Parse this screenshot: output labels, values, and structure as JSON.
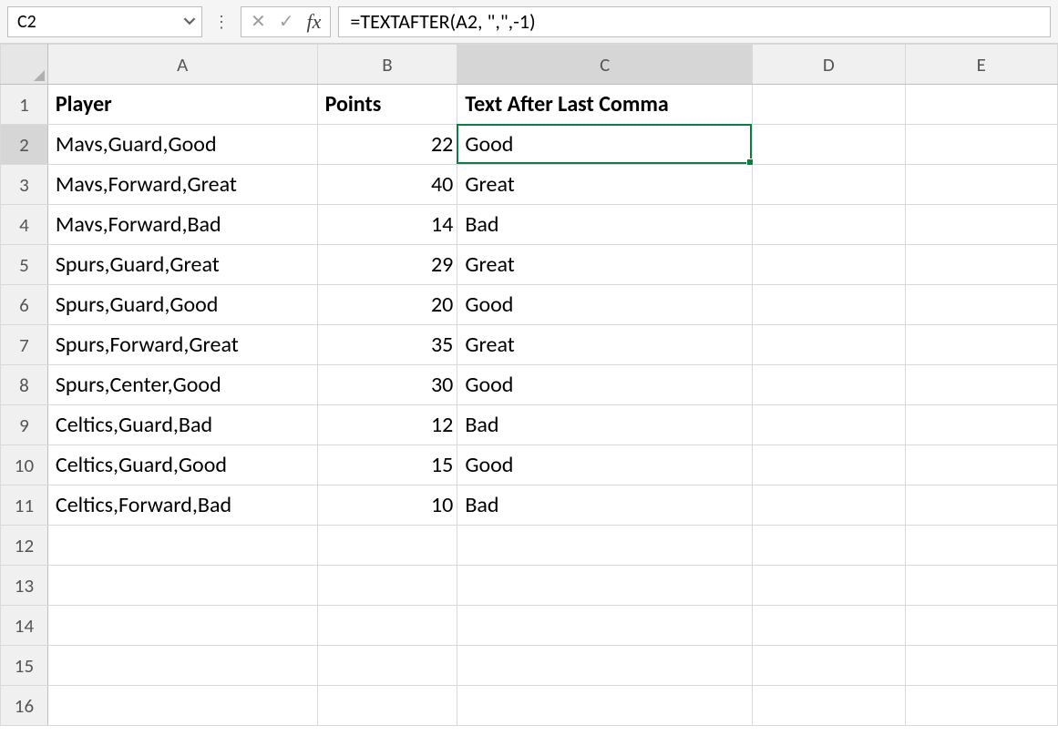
{
  "formula_bar": {
    "cell_ref": "C2",
    "formula": "=TEXTAFTER(A2, \",\",-1)"
  },
  "columns": [
    "A",
    "B",
    "C",
    "D",
    "E"
  ],
  "row_headers": [
    1,
    2,
    3,
    4,
    5,
    6,
    7,
    8,
    9,
    10,
    11,
    12,
    13,
    14,
    15,
    16
  ],
  "active_cell": {
    "col": "C",
    "row": 2
  },
  "headers": {
    "A": "Player",
    "B": "Points",
    "C": "Text After Last Comma"
  },
  "rows": [
    {
      "player": "Mavs,Guard,Good",
      "points": 22,
      "after": "Good"
    },
    {
      "player": "Mavs,Forward,Great",
      "points": 40,
      "after": "Great"
    },
    {
      "player": "Mavs,Forward,Bad",
      "points": 14,
      "after": "Bad"
    },
    {
      "player": "Spurs,Guard,Great",
      "points": 29,
      "after": "Great"
    },
    {
      "player": "Spurs,Guard,Good",
      "points": 20,
      "after": "Good"
    },
    {
      "player": "Spurs,Forward,Great",
      "points": 35,
      "after": "Great"
    },
    {
      "player": "Spurs,Center,Good",
      "points": 30,
      "after": "Good"
    },
    {
      "player": "Celtics,Guard,Bad",
      "points": 12,
      "after": "Bad"
    },
    {
      "player": "Celtics,Guard,Good",
      "points": 15,
      "after": "Good"
    },
    {
      "player": "Celtics,Forward,Bad",
      "points": 10,
      "after": "Bad"
    }
  ]
}
